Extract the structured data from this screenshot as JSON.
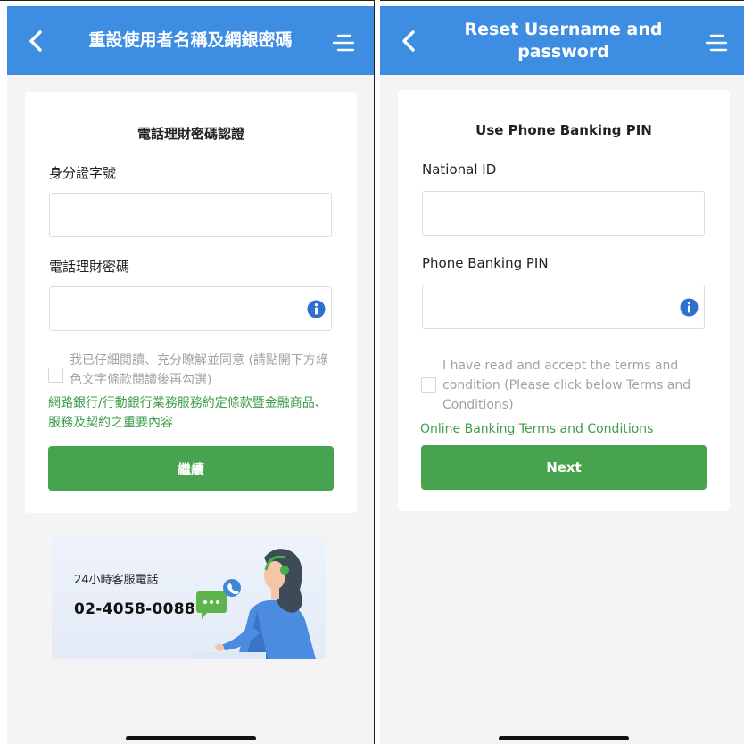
{
  "left": {
    "header": {
      "title": "重設使用者名稱及網銀密碼",
      "back_icon": "chevron-left-icon",
      "menu_icon": "menu-icon"
    },
    "card": {
      "title": "電話理財密碼認證",
      "field1_label": "身分證字號",
      "field1_value": "",
      "field2_label": "電話理財密碼",
      "field2_value": "",
      "consent_text": "我已仔細閱讀、充分瞭解並同意 (請點開下方綠色文字條款閱讀後再勾選)",
      "terms_link": "網路銀行/行動銀行業務服務約定條款暨金融商品、服務及契約之重要內容",
      "button_label": "繼續"
    },
    "banner": {
      "label": "24小時客服電話",
      "phone": "02-4058-0088"
    }
  },
  "right": {
    "header": {
      "title": "Reset Username and password",
      "back_icon": "chevron-left-icon",
      "menu_icon": "menu-icon"
    },
    "card": {
      "title": "Use Phone Banking PIN",
      "field1_label": "National ID",
      "field1_value": "",
      "field2_label": "Phone Banking PIN",
      "field2_value": "",
      "consent_text": "I have read and accept the terms and condition (Please click below Terms and Conditions)",
      "terms_link": "Online Banking Terms and Conditions",
      "button_label": "Next"
    }
  },
  "colors": {
    "header": "#3d8de2",
    "button": "#47a34e",
    "link": "#3e9d4a",
    "info": "#2f6fd0"
  }
}
